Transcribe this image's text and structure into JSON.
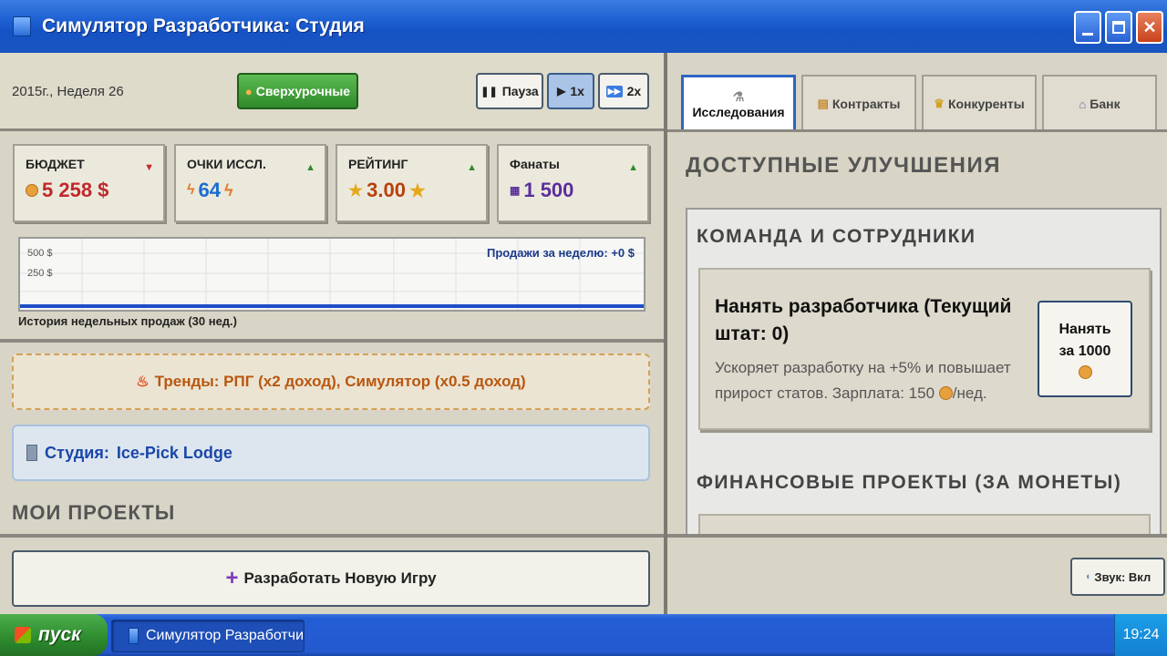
{
  "window": {
    "title": "Симулятор Разработчика: Студия"
  },
  "topbar": {
    "date": "2015г., Неделя 26",
    "overtime_label": "Сверхурочные",
    "speed": [
      {
        "label": "Пауза",
        "icon": "pause-icon",
        "active": false
      },
      {
        "label": "1x",
        "icon": "play-icon",
        "active": true
      },
      {
        "label": "2x",
        "icon": "fast-forward-icon",
        "active": false
      }
    ]
  },
  "stats": [
    {
      "label": "БЮДЖЕТ",
      "value": "5 258 $",
      "icon": "coin-icon",
      "trend": "down",
      "color": "#c0282c"
    },
    {
      "label": "ОЧКИ ИССЛ.",
      "value": "64",
      "icon": "lightning-icon",
      "trend": "up",
      "color": "#1a6cd0"
    },
    {
      "label": "РЕЙТИНГ",
      "value": "3.00",
      "icon": "star-icon",
      "trend": "up",
      "color": "#b8400a"
    },
    {
      "label": "Фанаты",
      "value": "1 500",
      "icon": "people-icon",
      "trend": "up",
      "color": "#5a2e9c"
    }
  ],
  "chart_data": {
    "type": "line",
    "title": "Продажи за неделю: +0 $",
    "xlabel": "История недельных продаж (30 нед.)",
    "ylabel": "",
    "y_ticks": [
      "500 $",
      "250 $"
    ],
    "ylim": [
      0,
      500
    ],
    "series": [
      {
        "values": [
          0,
          0,
          0,
          0,
          0,
          0,
          0,
          0,
          0,
          0,
          0,
          0,
          0,
          0,
          0,
          0,
          0,
          0,
          0,
          0,
          0,
          0,
          0,
          0,
          0,
          0,
          0,
          0,
          0,
          0
        ]
      }
    ]
  },
  "trends": {
    "text": "Тренды: РПГ (x2 доход), Симулятор (x0.5 доход)"
  },
  "studio": {
    "label": "Студия:",
    "name": "Ice-Pick Lodge"
  },
  "projects": {
    "heading": "МОИ ПРОЕКТЫ",
    "count": "0",
    "new_game_label": "Разработать Новую Игру"
  },
  "tabs": [
    {
      "label": "Исследования",
      "icon": "flask-icon",
      "active": true
    },
    {
      "label": "Контракты",
      "icon": "scroll-icon",
      "active": false
    },
    {
      "label": "Конкуренты",
      "icon": "trophy-icon",
      "active": false
    },
    {
      "label": "Банк",
      "icon": "bank-icon",
      "active": false
    }
  ],
  "upgrades": {
    "heading": "ДОСТУПНЫЕ УЛУЧШЕНИЯ",
    "team_heading": "КОМАНДА И СОТРУДНИКИ",
    "hire": {
      "title": "Нанять разработчика (Текущий штат: 0)",
      "desc_part1": "Ускоряет разработку на +5% и повышает прирост статов. Зарплата: 150",
      "desc_part2": "/нед.",
      "button_line1": "Нанять",
      "button_line2": "за 1000"
    },
    "finance_heading": "ФИНАНСОВЫЕ ПРОЕКТЫ (ЗА МОНЕТЫ)"
  },
  "sound": {
    "label": "Звук: Вкл"
  },
  "taskbar": {
    "start_label": "пуск",
    "task_label": "Симулятор Разработчи",
    "clock": "19:24"
  },
  "colors": {
    "accent": "#2f64c4",
    "titlebar": "#1d5fd1",
    "taskbar": "#245ed6"
  }
}
